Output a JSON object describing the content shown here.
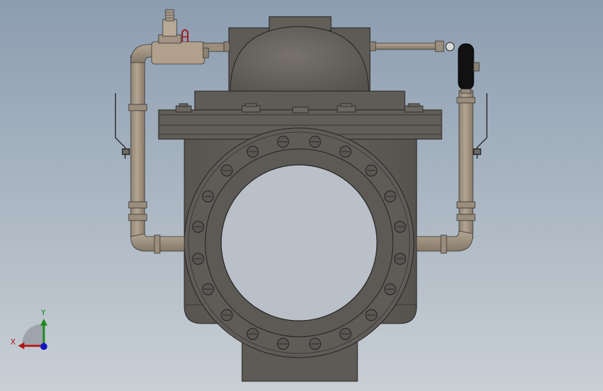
{
  "viewport": {
    "background_top": "#8c9db0",
    "background_bottom": "#c9cfd5"
  },
  "model": {
    "body_color": "#5f5c57",
    "dome_color": "#6d6963",
    "pipe_color": "#a39585",
    "pilot_body_color": "#b0a08c",
    "pilot_label_mark": "A"
  },
  "triad": {
    "x_label": "X",
    "y_label": "Y",
    "x_color": "#b01818",
    "y_color": "#1b8a1b",
    "z_color": "#1414c0"
  }
}
